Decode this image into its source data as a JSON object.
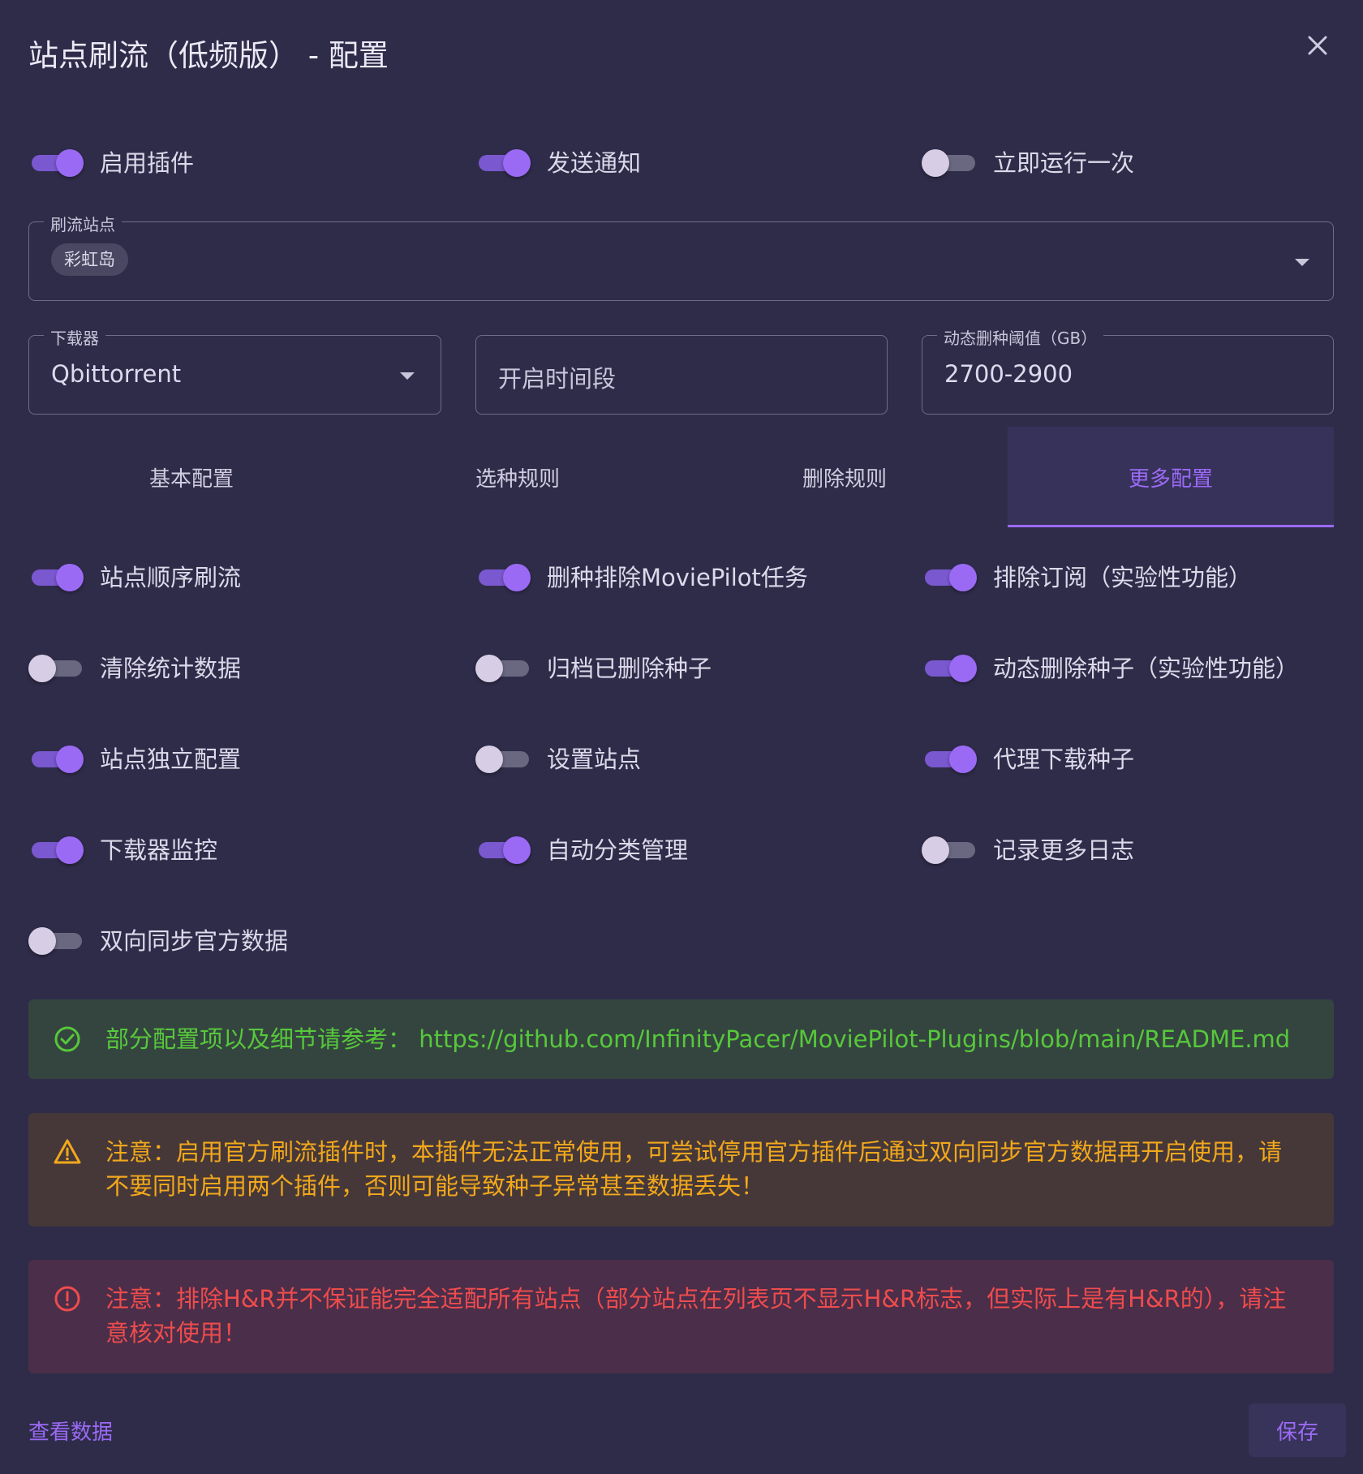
{
  "dialog": {
    "title": "站点刷流（低频版） - 配置"
  },
  "top_switches": [
    {
      "label": "启用插件",
      "on": true
    },
    {
      "label": "发送通知",
      "on": true
    },
    {
      "label": "立即运行一次",
      "on": false
    }
  ],
  "brush_sites": {
    "label": "刷流站点",
    "selected": [
      "彩虹岛"
    ]
  },
  "downloader": {
    "label": "下载器",
    "value": "Qbittorrent"
  },
  "time_range": {
    "placeholder": "开启时间段"
  },
  "delete_threshold": {
    "label": "动态删种阈值（GB）",
    "value": "2700-2900"
  },
  "tabs": [
    {
      "label": "基本配置",
      "active": false
    },
    {
      "label": "选种规则",
      "active": false
    },
    {
      "label": "删除规则",
      "active": false
    },
    {
      "label": "更多配置",
      "active": true
    }
  ],
  "more_switches": [
    {
      "label": "站点顺序刷流",
      "on": true
    },
    {
      "label": "删种排除MoviePilot任务",
      "on": true
    },
    {
      "label": "排除订阅（实验性功能）",
      "on": true
    },
    {
      "label": "清除统计数据",
      "on": false
    },
    {
      "label": "归档已删除种子",
      "on": false
    },
    {
      "label": "动态删除种子（实验性功能）",
      "on": true
    },
    {
      "label": "站点独立配置",
      "on": true
    },
    {
      "label": "设置站点",
      "on": false
    },
    {
      "label": "代理下载种子",
      "on": true
    },
    {
      "label": "下载器监控",
      "on": true
    },
    {
      "label": "自动分类管理",
      "on": true
    },
    {
      "label": "记录更多日志",
      "on": false
    },
    {
      "label": "双向同步官方数据",
      "on": false
    }
  ],
  "alerts": {
    "success": "部分配置项以及细节请参考： https://github.com/InfinityPacer/MoviePilot-Plugins/blob/main/README.md",
    "warning": "注意：启用官方刷流插件时，本插件无法正常使用，可尝试停用官方插件后通过双向同步官方数据再开启使用，请不要同时启用两个插件，否则可能导致种子异常甚至数据丢失！",
    "error": "注意：排除H&R并不保证能完全适配所有站点（部分站点在列表页不显示H&R标志，但实际上是有H&R的），请注意核对使用！"
  },
  "footer": {
    "view_data": "查看数据",
    "save": "保存"
  },
  "colors": {
    "background": "#2f2c4a",
    "accent": "#9b6af5",
    "success": "#57c83b",
    "warning": "#f2a81b",
    "error": "#ef4c4c"
  },
  "icons": {
    "close": "close-icon",
    "dropdown": "chevron-down-icon",
    "success": "check-circle-icon",
    "warning": "warning-triangle-icon",
    "error": "error-circle-icon"
  }
}
